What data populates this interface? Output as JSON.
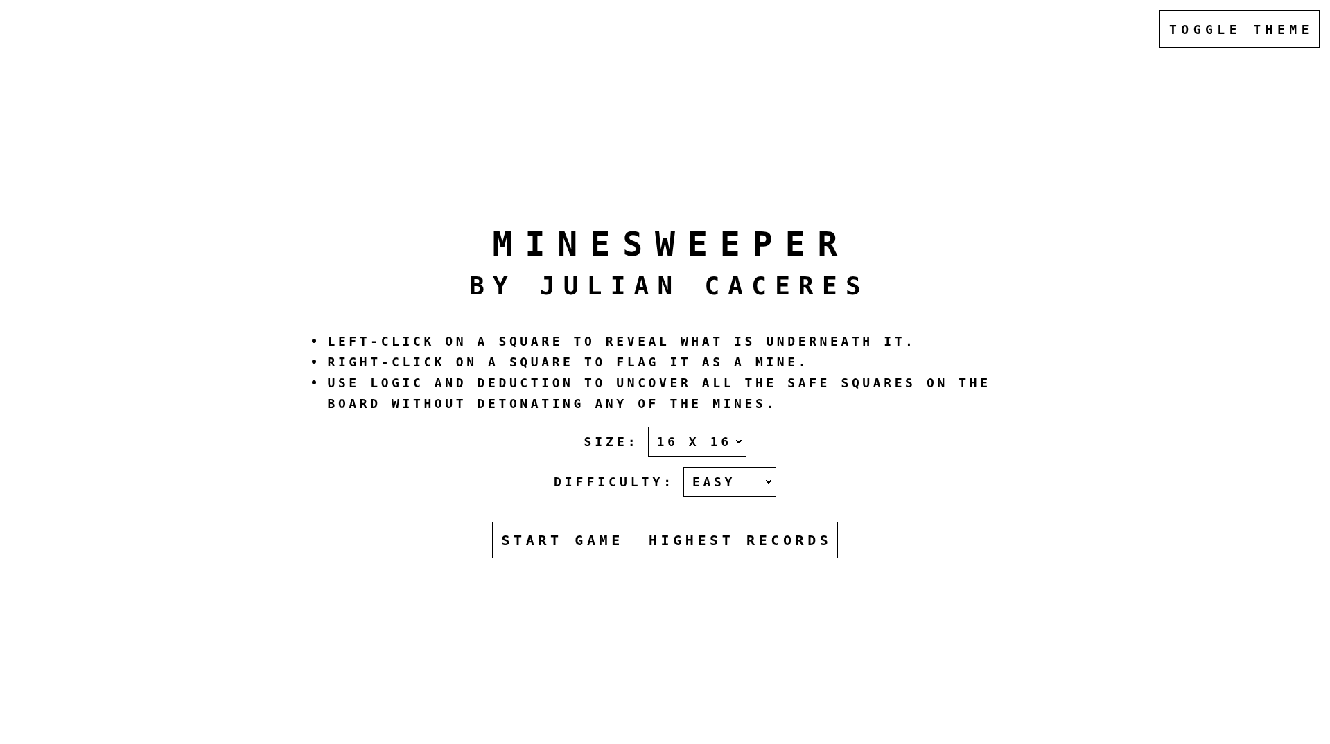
{
  "header": {
    "theme_button": "TOGGLE THEME"
  },
  "title": "MINESWEEPER",
  "subtitle": "BY JULIAN CACERES",
  "instructions": [
    "LEFT-CLICK ON A SQUARE TO REVEAL WHAT IS UNDERNEATH IT.",
    "RIGHT-CLICK ON A SQUARE TO FLAG IT AS A MINE.",
    "USE LOGIC AND DEDUCTION TO UNCOVER ALL THE SAFE SQUARES ON THE BOARD WITHOUT DETONATING ANY OF THE MINES."
  ],
  "settings": {
    "size": {
      "label": "SIZE:",
      "value": "16 X 16"
    },
    "difficulty": {
      "label": "DIFFICULTY:",
      "value": "EASY"
    }
  },
  "actions": {
    "start_button": "START GAME",
    "records_button": "HIGHEST RECORDS"
  }
}
